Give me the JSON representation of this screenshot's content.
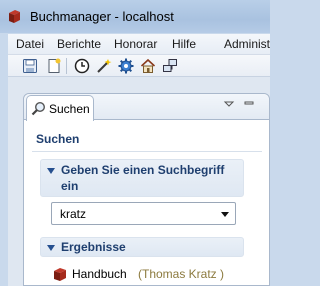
{
  "window": {
    "title": "Buchmanager - localhost"
  },
  "menubar": {
    "items": [
      "Datei",
      "Berichte",
      "Honorar",
      "Hilfe",
      "Administ"
    ]
  },
  "toolbar": {
    "buttons": [
      "save-icon",
      "new-document-icon",
      "clock-icon",
      "wand-icon",
      "gear-icon",
      "home-icon",
      "network-icon"
    ]
  },
  "view": {
    "tab_label": "Suchen",
    "form_title": "Suchen",
    "search_section": {
      "title_line1": "Geben Sie einen Suchbegriff",
      "title_line2": "ein",
      "combo_value": "kratz"
    },
    "results_section": {
      "title": "Ergebnisse",
      "items": [
        {
          "title": "Handbuch",
          "author": "(Thomas Kratz )"
        }
      ]
    }
  },
  "colors": {
    "section_title": "#1f3f6f",
    "author_text": "#8c7a3e",
    "titlebar": "#a9c2e0"
  }
}
